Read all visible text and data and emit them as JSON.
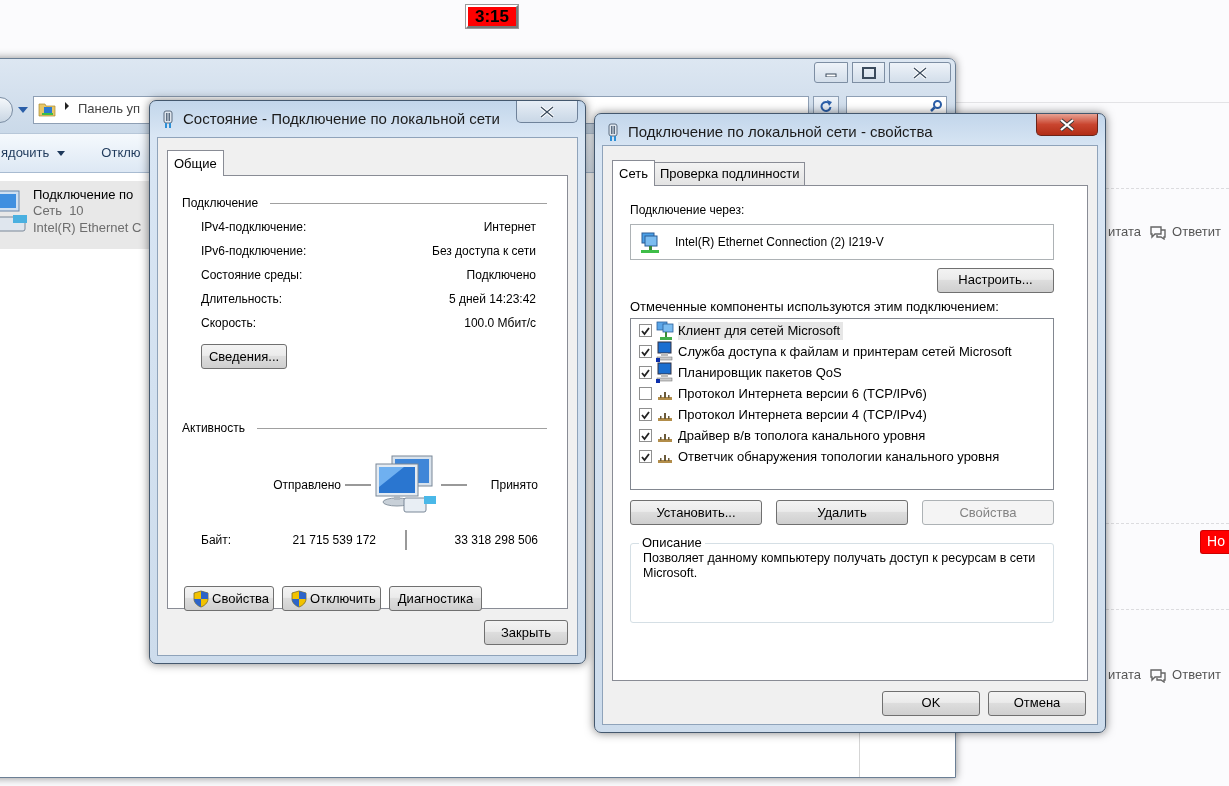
{
  "timer": {
    "text": "3:15"
  },
  "web_page": {
    "reply_rows": [
      {
        "quote": "итата",
        "reply": "Ответит"
      },
      {
        "quote": "итата",
        "reply": "Ответит"
      }
    ],
    "badge": "Но"
  },
  "explorer": {
    "address": "Панель уп",
    "toolbar": [
      {
        "label": "ядочить",
        "dropdown": true
      },
      {
        "label": "Отклю",
        "dropdown": false
      }
    ],
    "items": [
      {
        "name": "Подключение по",
        "network": "Сеть  10",
        "adapter": "Intel(R) Ethernet C",
        "selected": true
      }
    ]
  },
  "status_dialog": {
    "title": "Состояние - Подключение по локальной сети",
    "tabs": [
      {
        "label": "Общие",
        "selected": true
      }
    ],
    "connection": {
      "heading": "Подключение",
      "rows": [
        {
          "label": "IPv4-подключение:",
          "value": "Интернет"
        },
        {
          "label": "IPv6-подключение:",
          "value": "Без доступа к сети"
        },
        {
          "label": "Состояние среды:",
          "value": "Подключено"
        },
        {
          "label": "Длительность:",
          "value": "5 дней 14:23:42"
        },
        {
          "label": "Скорость:",
          "value": "100.0 Мбит/с"
        }
      ],
      "details_button": "Сведения..."
    },
    "activity": {
      "heading": "Активность",
      "sent_label": "Отправлено",
      "received_label": "Принято",
      "bytes_label": "Байт:",
      "sent": "21 715 539 172",
      "received": "33 318 298 506"
    },
    "buttons": [
      {
        "label": "Свойства",
        "shield": true
      },
      {
        "label": "Отключить",
        "shield": true
      },
      {
        "label": "Диагностика",
        "shield": false
      }
    ],
    "close_button": "Закрыть"
  },
  "properties_dialog": {
    "title": "Подключение по локальной сети - свойства",
    "tabs": [
      {
        "label": "Сеть",
        "selected": true
      },
      {
        "label": "Проверка подлинности",
        "selected": false
      }
    ],
    "connect_via_label": "Подключение через:",
    "adapter": "Intel(R) Ethernet Connection (2) I219-V",
    "configure_button": "Настроить...",
    "components_label": "Отмеченные компоненты используются этим подключением:",
    "components": [
      {
        "label": "Клиент для сетей Microsoft",
        "kind": "client",
        "checked": true,
        "selected": true
      },
      {
        "label": "Служба доступа к файлам и принтерам сетей Microsoft",
        "kind": "service",
        "checked": true,
        "selected": false
      },
      {
        "label": "Планировщик пакетов QoS",
        "kind": "service",
        "checked": true,
        "selected": false
      },
      {
        "label": "Протокол Интернета версии 6 (TCP/IPv6)",
        "kind": "protocol",
        "checked": false,
        "selected": false
      },
      {
        "label": "Протокол Интернета версии 4 (TCP/IPv4)",
        "kind": "protocol",
        "checked": true,
        "selected": false
      },
      {
        "label": "Драйвер в/в тополога канального уровня",
        "kind": "protocol",
        "checked": true,
        "selected": false
      },
      {
        "label": "Ответчик обнаружения топологии канального уровня",
        "kind": "protocol",
        "checked": true,
        "selected": false
      }
    ],
    "component_buttons": [
      {
        "label": "Установить...",
        "disabled": false
      },
      {
        "label": "Удалить",
        "disabled": false
      },
      {
        "label": "Свойства",
        "disabled": true
      }
    ],
    "description": {
      "legend": "Описание",
      "text": "Позволяет данному компьютеру получать доступ к ресурсам в сети Microsoft."
    },
    "footer_buttons": [
      "OK",
      "Отмена"
    ]
  }
}
